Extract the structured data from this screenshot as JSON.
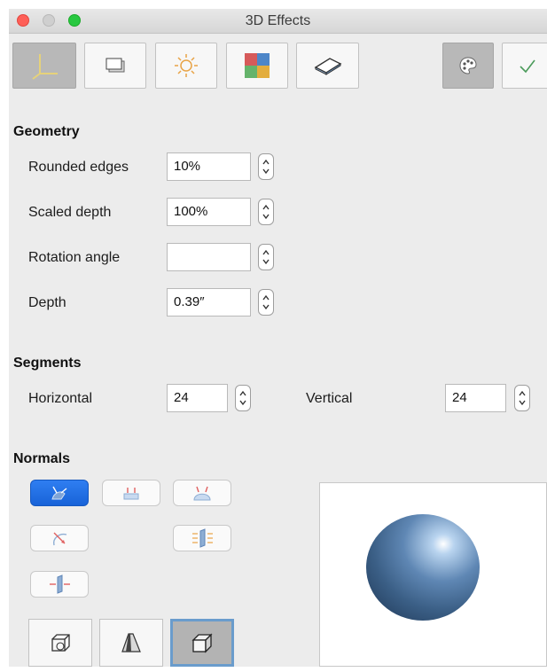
{
  "window": {
    "title": "3D Effects"
  },
  "toolbar": {
    "icons": [
      "geometry-axes-icon",
      "shading-icon",
      "illumination-icon",
      "textures-icon",
      "material-icon",
      "palette-icon",
      "checkmark-icon"
    ]
  },
  "geometry": {
    "heading": "Geometry",
    "rounded_edges": {
      "label": "Rounded edges",
      "value": "10%"
    },
    "scaled_depth": {
      "label": "Scaled depth",
      "value": "100%"
    },
    "rotation_angle": {
      "label": "Rotation angle",
      "value": ""
    },
    "depth": {
      "label": "Depth",
      "value": "0.39″"
    }
  },
  "segments": {
    "heading": "Segments",
    "horizontal": {
      "label": "Horizontal",
      "value": "24"
    },
    "vertical": {
      "label": "Vertical",
      "value": "24"
    }
  },
  "normals": {
    "heading": "Normals",
    "selected": "object-specific"
  },
  "colors": {
    "accent": "#1863d8",
    "sphere": "#4a6c93",
    "highlight": "#ffffff"
  }
}
